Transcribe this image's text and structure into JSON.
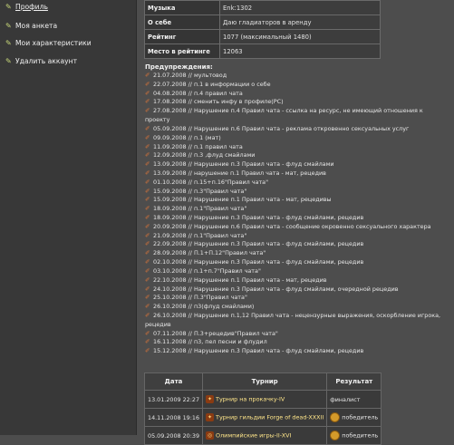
{
  "sidebar": {
    "items": [
      {
        "label": "Профиль",
        "icon": "pen-icon",
        "active": true
      },
      {
        "label": "Моя анкета",
        "icon": "pen-icon"
      },
      {
        "label": "Мои характеристики",
        "icon": "pen-icon"
      },
      {
        "label": "Удалить аккаунт",
        "icon": "pen-icon"
      }
    ]
  },
  "info": {
    "rows": [
      {
        "key": "Музыка",
        "value": "Enk:1302"
      },
      {
        "key": "О себе",
        "value": "Даю гладиаторов в аренду"
      },
      {
        "key": "Рейтинг",
        "value": "1077 (максимальный 1480)"
      },
      {
        "key": "Место в рейтинге",
        "value": "12063"
      }
    ]
  },
  "warnings": {
    "title": "Предупреждения:",
    "items": [
      "21.07.2008 // мультовод",
      "22.07.2008 // п.1 в информации о себе",
      "04.08.2008 // п.4 правил чата",
      "17.08.2008 // сменить инфу в профиле(PC)",
      "27.08.2008 // Нарушение п.4 Правил чата - ссылка на ресурс, не имеющий отношения к",
      "проекту",
      "05.09.2008 // Нарушение п.6 Правил чата - реклама откровенно сексуальных услуг",
      "09.09.2008 // п.1 (мат)",
      "11.09.2008 // п.1 правил чата",
      "12.09.2008 // п.3 ,флуд смайлами",
      "13.09.2008 // Нарушение п.3 Правил чата - флуд смайлами",
      "13.09.2008 // нарушение п.1 Правил чата - мат, рецедив",
      "01.10.2008 // п.15+п.16\"Правил чата\"",
      "15.09.2008 // п.3\"Правил чата\"",
      "15.09.2008 // Нарушение п.1 Правил чата - мат, рецедивы",
      "18.09.2008 // п.1\"Правил чата\"",
      "18.09.2008 // Нарушение п.3 Правил чата - флуд смайлами, рецедив",
      "20.09.2008 // Нарушение п.6 Правил чата - сообщение окровенно сексуального характера",
      "21.09.2008 // п.1\"Правил чата\"",
      "22.09.2008 // Нарушение п.3 Правил чата - флуд смайлами, рецедив",
      "28.09.2008 // П.1+П.12\"Правил чата\"",
      "02.10.2008 // Нарушение п.3 Правил чата - флуд смайлами, рецедив",
      "03.10.2008 // п.1+п.7\"Правил чата\"",
      "22.10.2008 // Нарушение п.1 Правил чата - мат, рецедив",
      "24.10.2008 // Нарушение п.3 Правил чата - флуд смайлами, очередной рецедив",
      "25.10.2008 // П.3\"Правил чата\"",
      "26.10.2008 // п3(флуд смайлами)",
      "26.10.2008 // Нарушение п.1,12 Правил чата - нецензурные выражения, оскорбление игрока,",
      "рецедив",
      "07.11.2008 // П.3+рецедив\"Правил чата\"",
      "16.11.2008 // п3, пел песни и флудил",
      "15.12.2008 // Нарушение п.3 Правил чата - флуд смайлами, рецедив"
    ]
  },
  "results": {
    "headers": [
      "Дата",
      "Турнир",
      "Результат"
    ],
    "rows": [
      {
        "date": "13.01.2009 22:27",
        "tournament": "Турнир на прокачку-IV",
        "result": "финалист",
        "icon": "shield-icon",
        "medal": false
      },
      {
        "date": "14.11.2008 19:16",
        "tournament": "Турнир гильдии Forge of dead-XXXII",
        "result": "победитель",
        "icon": "shield-icon",
        "medal": true
      },
      {
        "date": "05.09.2008 20:39",
        "tournament": "Олимпийские игры-II-XVI",
        "result": "победитель",
        "icon": "olympic-icon",
        "medal": true
      }
    ]
  }
}
